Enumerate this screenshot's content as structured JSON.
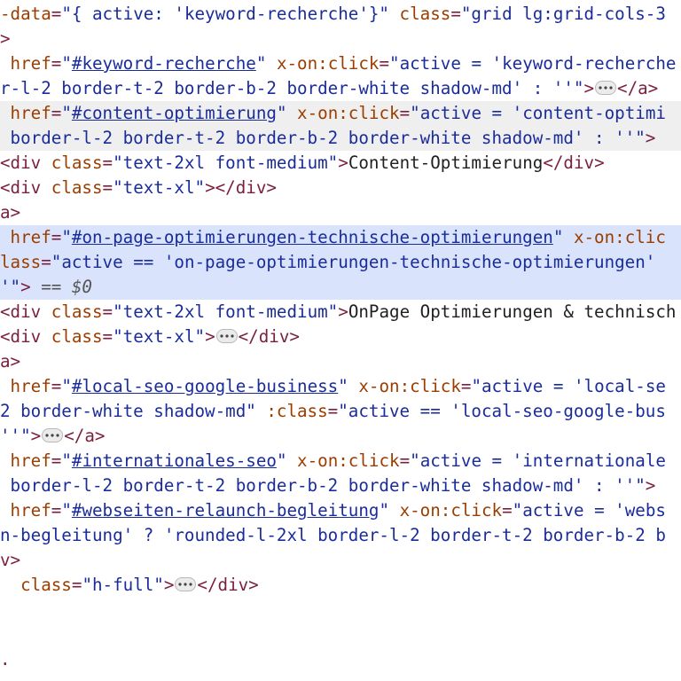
{
  "ellipsis": "•••",
  "lines": [
    {
      "hl": "none",
      "segs": [
        {
          "c": "a",
          "t": "-data"
        },
        {
          "c": "t",
          "t": "="
        },
        {
          "c": "v",
          "t": "\"{ active: 'keyword-recherche'}\""
        },
        {
          "c": "a",
          "t": " class"
        },
        {
          "c": "t",
          "t": "="
        },
        {
          "c": "v",
          "t": "\"grid lg:grid-cols-3"
        }
      ]
    },
    {
      "hl": "none",
      "segs": [
        {
          "c": "t",
          "t": ">"
        }
      ]
    },
    {
      "hl": "none",
      "segs": [
        {
          "c": "a",
          "t": " href"
        },
        {
          "c": "t",
          "t": "="
        },
        {
          "c": "v",
          "t": "\""
        },
        {
          "c": "vu",
          "t": "#keyword-recherche"
        },
        {
          "c": "v",
          "t": "\""
        },
        {
          "c": "a",
          "t": " x-on:click"
        },
        {
          "c": "t",
          "t": "="
        },
        {
          "c": "v",
          "t": "\"active = 'keyword-recherche"
        }
      ]
    },
    {
      "hl": "none",
      "segs": [
        {
          "c": "v",
          "t": "r-l-2 border-t-2 border-b-2 border-white shadow-md' : ''\""
        },
        {
          "c": "t",
          "t": ">"
        },
        {
          "c": "ell",
          "t": ""
        },
        {
          "c": "t",
          "t": "</a>"
        }
      ]
    },
    {
      "hl": "gray",
      "segs": [
        {
          "c": "a",
          "t": " href"
        },
        {
          "c": "t",
          "t": "="
        },
        {
          "c": "v",
          "t": "\""
        },
        {
          "c": "vu",
          "t": "#content-optimierung"
        },
        {
          "c": "v",
          "t": "\""
        },
        {
          "c": "a",
          "t": " x-on:click"
        },
        {
          "c": "t",
          "t": "="
        },
        {
          "c": "v",
          "t": "\"active = 'content-optimi"
        }
      ]
    },
    {
      "hl": "gray",
      "segs": [
        {
          "c": "v",
          "t": " border-l-2 border-t-2 border-b-2 border-white shadow-md' : ''\""
        },
        {
          "c": "t",
          "t": ">"
        }
      ]
    },
    {
      "hl": "none",
      "segs": [
        {
          "c": "t",
          "t": "<div"
        },
        {
          "c": "a",
          "t": " class"
        },
        {
          "c": "t",
          "t": "="
        },
        {
          "c": "v",
          "t": "\"text-2xl font-medium\""
        },
        {
          "c": "t",
          "t": ">"
        },
        {
          "c": "tx",
          "t": "Content-Optimierung"
        },
        {
          "c": "t",
          "t": "</div>"
        }
      ]
    },
    {
      "hl": "none",
      "segs": [
        {
          "c": "t",
          "t": "<div"
        },
        {
          "c": "a",
          "t": " class"
        },
        {
          "c": "t",
          "t": "="
        },
        {
          "c": "v",
          "t": "\"text-xl\""
        },
        {
          "c": "t",
          "t": "></div>"
        }
      ]
    },
    {
      "hl": "none",
      "segs": [
        {
          "c": "t",
          "t": "a>"
        }
      ]
    },
    {
      "hl": "sel",
      "segs": [
        {
          "c": "a",
          "t": " href"
        },
        {
          "c": "t",
          "t": "="
        },
        {
          "c": "v",
          "t": "\""
        },
        {
          "c": "vu",
          "t": "#on-page-optimierungen-technische-optimierungen"
        },
        {
          "c": "v",
          "t": "\""
        },
        {
          "c": "a",
          "t": " x-on:clic"
        }
      ]
    },
    {
      "hl": "sel",
      "segs": [
        {
          "c": "a",
          "t": "lass"
        },
        {
          "c": "t",
          "t": "="
        },
        {
          "c": "v",
          "t": "\"active == 'on-page-optimierungen-technische-optimierungen' "
        }
      ]
    },
    {
      "hl": "sel",
      "segs": [
        {
          "c": "v",
          "t": "'\""
        },
        {
          "c": "t",
          "t": ">"
        },
        {
          "c": "dim",
          "t": " == $0"
        }
      ]
    },
    {
      "hl": "none",
      "segs": [
        {
          "c": "t",
          "t": "<div"
        },
        {
          "c": "a",
          "t": " class"
        },
        {
          "c": "t",
          "t": "="
        },
        {
          "c": "v",
          "t": "\"text-2xl font-medium\""
        },
        {
          "c": "t",
          "t": ">"
        },
        {
          "c": "tx",
          "t": "OnPage Optimierungen & technisch"
        }
      ]
    },
    {
      "hl": "none",
      "segs": [
        {
          "c": "t",
          "t": "<div"
        },
        {
          "c": "a",
          "t": " class"
        },
        {
          "c": "t",
          "t": "="
        },
        {
          "c": "v",
          "t": "\"text-xl\""
        },
        {
          "c": "t",
          "t": ">"
        },
        {
          "c": "ell",
          "t": ""
        },
        {
          "c": "t",
          "t": "</div>"
        }
      ]
    },
    {
      "hl": "none",
      "segs": [
        {
          "c": "t",
          "t": "a>"
        }
      ]
    },
    {
      "hl": "none",
      "segs": [
        {
          "c": "a",
          "t": " href"
        },
        {
          "c": "t",
          "t": "="
        },
        {
          "c": "v",
          "t": "\""
        },
        {
          "c": "vu",
          "t": "#local-seo-google-business"
        },
        {
          "c": "v",
          "t": "\""
        },
        {
          "c": "a",
          "t": " x-on:click"
        },
        {
          "c": "t",
          "t": "="
        },
        {
          "c": "v",
          "t": "\"active = 'local-se"
        }
      ]
    },
    {
      "hl": "none",
      "segs": [
        {
          "c": "v",
          "t": "2 border-white shadow-md\""
        },
        {
          "c": "a",
          "t": " :class"
        },
        {
          "c": "t",
          "t": "="
        },
        {
          "c": "v",
          "t": "\"active == 'local-seo-google-bus"
        }
      ]
    },
    {
      "hl": "none",
      "segs": [
        {
          "c": "v",
          "t": "''\""
        },
        {
          "c": "t",
          "t": ">"
        },
        {
          "c": "ell",
          "t": ""
        },
        {
          "c": "t",
          "t": "</a>"
        }
      ]
    },
    {
      "hl": "none",
      "segs": [
        {
          "c": "a",
          "t": " href"
        },
        {
          "c": "t",
          "t": "="
        },
        {
          "c": "v",
          "t": "\""
        },
        {
          "c": "vu",
          "t": "#internationales-seo"
        },
        {
          "c": "v",
          "t": "\""
        },
        {
          "c": "a",
          "t": " x-on:click"
        },
        {
          "c": "t",
          "t": "="
        },
        {
          "c": "v",
          "t": "\"active = 'internationale"
        }
      ]
    },
    {
      "hl": "none",
      "segs": [
        {
          "c": "v",
          "t": " border-l-2 border-t-2 border-b-2 border-white shadow-md' : ''\""
        },
        {
          "c": "t",
          "t": ">"
        }
      ]
    },
    {
      "hl": "none",
      "segs": [
        {
          "c": "a",
          "t": " href"
        },
        {
          "c": "t",
          "t": "="
        },
        {
          "c": "v",
          "t": "\""
        },
        {
          "c": "vu",
          "t": "#webseiten-relaunch-begleitung"
        },
        {
          "c": "v",
          "t": "\""
        },
        {
          "c": "a",
          "t": " x-on:click"
        },
        {
          "c": "t",
          "t": "="
        },
        {
          "c": "v",
          "t": "\"active = 'webs"
        }
      ]
    },
    {
      "hl": "none",
      "segs": [
        {
          "c": "v",
          "t": "n-begleitung' ? 'rounded-l-2xl border-l-2 border-t-2 border-b-2 b"
        }
      ]
    },
    {
      "hl": "none",
      "segs": [
        {
          "c": "t",
          "t": "v>"
        }
      ]
    },
    {
      "hl": "none",
      "segs": [
        {
          "c": "a",
          "t": "  class"
        },
        {
          "c": "t",
          "t": "="
        },
        {
          "c": "v",
          "t": "\"h-full\""
        },
        {
          "c": "t",
          "t": ">"
        },
        {
          "c": "ell",
          "t": ""
        },
        {
          "c": "t",
          "t": "</div>"
        }
      ]
    },
    {
      "hl": "none",
      "segs": []
    },
    {
      "hl": "none",
      "segs": []
    },
    {
      "hl": "none",
      "segs": [
        {
          "c": "t",
          "t": "."
        }
      ]
    }
  ]
}
